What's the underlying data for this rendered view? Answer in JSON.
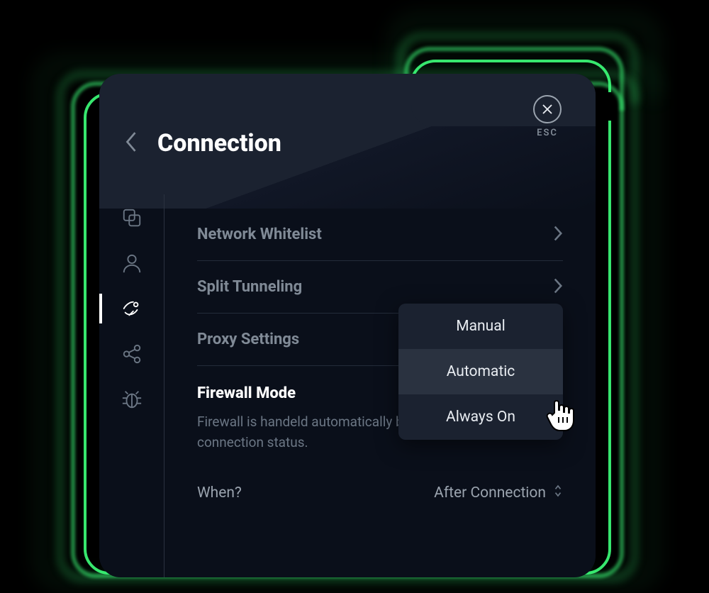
{
  "header": {
    "title": "Connection",
    "close_label": "ESC"
  },
  "sidebar": {
    "items": [
      {
        "name": "general",
        "active": false
      },
      {
        "name": "account",
        "active": false
      },
      {
        "name": "connection",
        "active": true
      },
      {
        "name": "share",
        "active": false
      },
      {
        "name": "debug",
        "active": false
      }
    ]
  },
  "rows": [
    {
      "label": "Network Whitelist"
    },
    {
      "label": "Split Tunneling"
    },
    {
      "label": "Proxy Settings"
    }
  ],
  "firewall": {
    "title": "Firewall Mode",
    "description": "Firewall is handeld automatically by Windscribe's connection status.",
    "sub_label": "When?",
    "sub_value": "After Connection"
  },
  "dropdown": {
    "options": [
      "Manual",
      "Automatic",
      "Always On"
    ],
    "hover_index": 1
  }
}
